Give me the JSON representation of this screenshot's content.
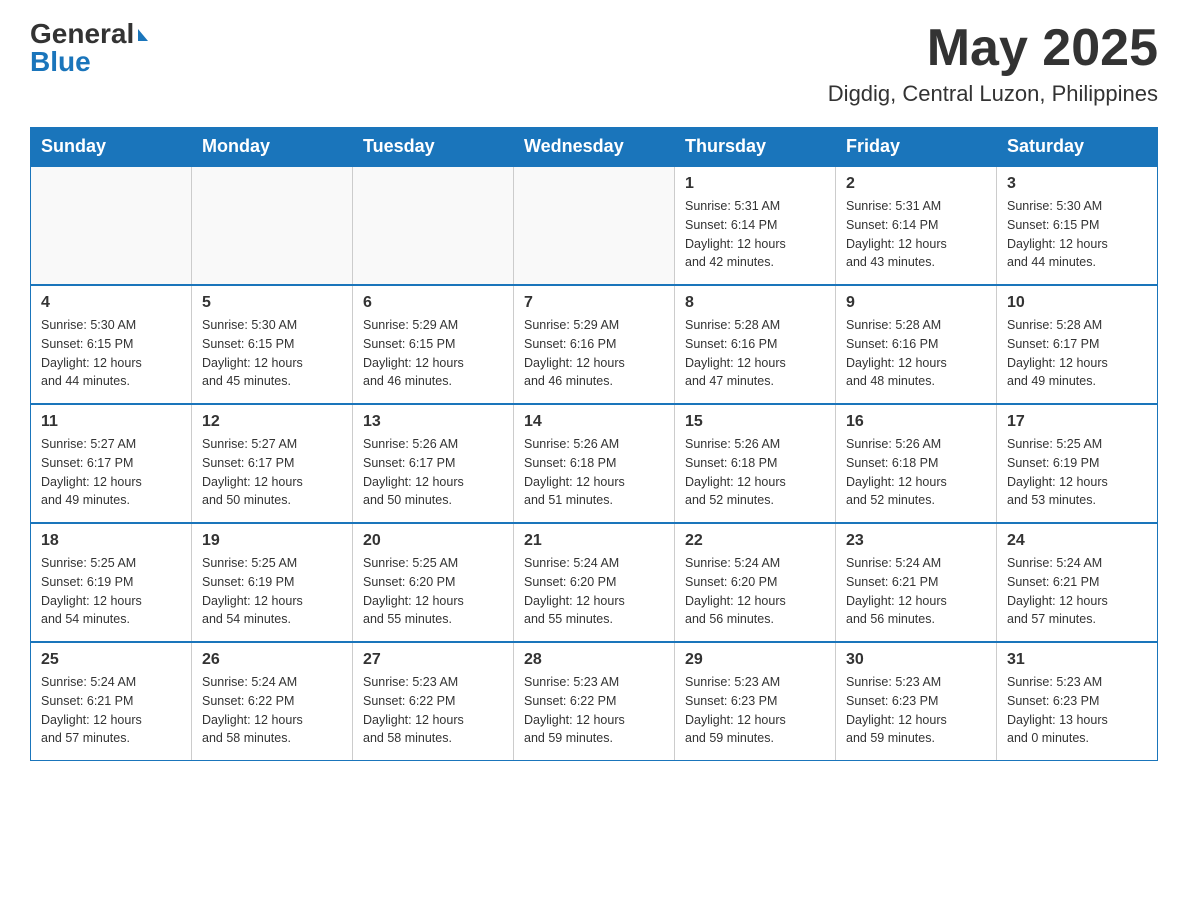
{
  "logo": {
    "general": "General",
    "blue": "Blue"
  },
  "header": {
    "month": "May 2025",
    "location": "Digdig, Central Luzon, Philippines"
  },
  "days_of_week": [
    "Sunday",
    "Monday",
    "Tuesday",
    "Wednesday",
    "Thursday",
    "Friday",
    "Saturday"
  ],
  "weeks": [
    [
      {
        "day": "",
        "info": ""
      },
      {
        "day": "",
        "info": ""
      },
      {
        "day": "",
        "info": ""
      },
      {
        "day": "",
        "info": ""
      },
      {
        "day": "1",
        "info": "Sunrise: 5:31 AM\nSunset: 6:14 PM\nDaylight: 12 hours\nand 42 minutes."
      },
      {
        "day": "2",
        "info": "Sunrise: 5:31 AM\nSunset: 6:14 PM\nDaylight: 12 hours\nand 43 minutes."
      },
      {
        "day": "3",
        "info": "Sunrise: 5:30 AM\nSunset: 6:15 PM\nDaylight: 12 hours\nand 44 minutes."
      }
    ],
    [
      {
        "day": "4",
        "info": "Sunrise: 5:30 AM\nSunset: 6:15 PM\nDaylight: 12 hours\nand 44 minutes."
      },
      {
        "day": "5",
        "info": "Sunrise: 5:30 AM\nSunset: 6:15 PM\nDaylight: 12 hours\nand 45 minutes."
      },
      {
        "day": "6",
        "info": "Sunrise: 5:29 AM\nSunset: 6:15 PM\nDaylight: 12 hours\nand 46 minutes."
      },
      {
        "day": "7",
        "info": "Sunrise: 5:29 AM\nSunset: 6:16 PM\nDaylight: 12 hours\nand 46 minutes."
      },
      {
        "day": "8",
        "info": "Sunrise: 5:28 AM\nSunset: 6:16 PM\nDaylight: 12 hours\nand 47 minutes."
      },
      {
        "day": "9",
        "info": "Sunrise: 5:28 AM\nSunset: 6:16 PM\nDaylight: 12 hours\nand 48 minutes."
      },
      {
        "day": "10",
        "info": "Sunrise: 5:28 AM\nSunset: 6:17 PM\nDaylight: 12 hours\nand 49 minutes."
      }
    ],
    [
      {
        "day": "11",
        "info": "Sunrise: 5:27 AM\nSunset: 6:17 PM\nDaylight: 12 hours\nand 49 minutes."
      },
      {
        "day": "12",
        "info": "Sunrise: 5:27 AM\nSunset: 6:17 PM\nDaylight: 12 hours\nand 50 minutes."
      },
      {
        "day": "13",
        "info": "Sunrise: 5:26 AM\nSunset: 6:17 PM\nDaylight: 12 hours\nand 50 minutes."
      },
      {
        "day": "14",
        "info": "Sunrise: 5:26 AM\nSunset: 6:18 PM\nDaylight: 12 hours\nand 51 minutes."
      },
      {
        "day": "15",
        "info": "Sunrise: 5:26 AM\nSunset: 6:18 PM\nDaylight: 12 hours\nand 52 minutes."
      },
      {
        "day": "16",
        "info": "Sunrise: 5:26 AM\nSunset: 6:18 PM\nDaylight: 12 hours\nand 52 minutes."
      },
      {
        "day": "17",
        "info": "Sunrise: 5:25 AM\nSunset: 6:19 PM\nDaylight: 12 hours\nand 53 minutes."
      }
    ],
    [
      {
        "day": "18",
        "info": "Sunrise: 5:25 AM\nSunset: 6:19 PM\nDaylight: 12 hours\nand 54 minutes."
      },
      {
        "day": "19",
        "info": "Sunrise: 5:25 AM\nSunset: 6:19 PM\nDaylight: 12 hours\nand 54 minutes."
      },
      {
        "day": "20",
        "info": "Sunrise: 5:25 AM\nSunset: 6:20 PM\nDaylight: 12 hours\nand 55 minutes."
      },
      {
        "day": "21",
        "info": "Sunrise: 5:24 AM\nSunset: 6:20 PM\nDaylight: 12 hours\nand 55 minutes."
      },
      {
        "day": "22",
        "info": "Sunrise: 5:24 AM\nSunset: 6:20 PM\nDaylight: 12 hours\nand 56 minutes."
      },
      {
        "day": "23",
        "info": "Sunrise: 5:24 AM\nSunset: 6:21 PM\nDaylight: 12 hours\nand 56 minutes."
      },
      {
        "day": "24",
        "info": "Sunrise: 5:24 AM\nSunset: 6:21 PM\nDaylight: 12 hours\nand 57 minutes."
      }
    ],
    [
      {
        "day": "25",
        "info": "Sunrise: 5:24 AM\nSunset: 6:21 PM\nDaylight: 12 hours\nand 57 minutes."
      },
      {
        "day": "26",
        "info": "Sunrise: 5:24 AM\nSunset: 6:22 PM\nDaylight: 12 hours\nand 58 minutes."
      },
      {
        "day": "27",
        "info": "Sunrise: 5:23 AM\nSunset: 6:22 PM\nDaylight: 12 hours\nand 58 minutes."
      },
      {
        "day": "28",
        "info": "Sunrise: 5:23 AM\nSunset: 6:22 PM\nDaylight: 12 hours\nand 59 minutes."
      },
      {
        "day": "29",
        "info": "Sunrise: 5:23 AM\nSunset: 6:23 PM\nDaylight: 12 hours\nand 59 minutes."
      },
      {
        "day": "30",
        "info": "Sunrise: 5:23 AM\nSunset: 6:23 PM\nDaylight: 12 hours\nand 59 minutes."
      },
      {
        "day": "31",
        "info": "Sunrise: 5:23 AM\nSunset: 6:23 PM\nDaylight: 13 hours\nand 0 minutes."
      }
    ]
  ]
}
